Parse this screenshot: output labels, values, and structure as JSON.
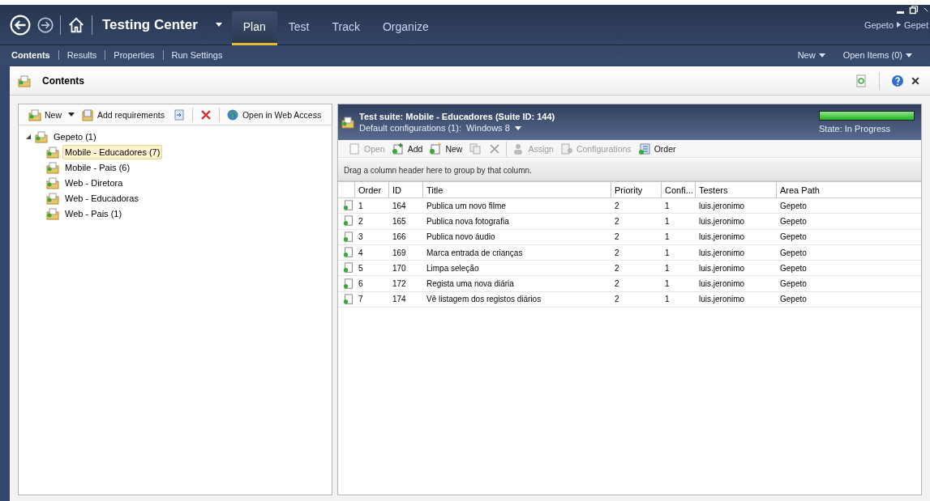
{
  "app_title": "Testing Center",
  "tabs": [
    {
      "label": "Plan",
      "selected": true
    },
    {
      "label": "Test",
      "selected": false
    },
    {
      "label": "Track",
      "selected": false
    },
    {
      "label": "Organize",
      "selected": false
    }
  ],
  "breadcrumb": [
    "Gepeto",
    "Gepet"
  ],
  "subtabs": [
    {
      "label": "Contents",
      "selected": true
    },
    {
      "label": "Results",
      "selected": false
    },
    {
      "label": "Properties",
      "selected": false
    },
    {
      "label": "Run Settings",
      "selected": false
    }
  ],
  "right_menus": [
    "New",
    "Open Items (0)"
  ],
  "panel_title": "Contents",
  "left_toolbar": [
    {
      "kind": "new",
      "label": "New"
    },
    {
      "kind": "requirements",
      "label": "Add requirements"
    },
    {
      "kind": "suite"
    },
    {
      "kind": "delete"
    },
    {
      "kind": "web",
      "label": "Open in Web Access"
    }
  ],
  "tree": {
    "label": "Gepeto (1)",
    "expanded": true,
    "selected": false,
    "children": [
      {
        "label": "Mobile - Educadores (7)",
        "selected": true
      },
      {
        "label": "Mobile - Pais (6)",
        "selected": false
      },
      {
        "label": "Web - Diretora",
        "selected": false
      },
      {
        "label": "Web - Educadoras",
        "selected": false
      },
      {
        "label": "Web - Pais (1)",
        "selected": false
      }
    ]
  },
  "suite": {
    "title": "Test suite:  Mobile - Educadores (Suite ID: 144)",
    "config_label": "Default configurations (1):",
    "config_value": "Windows 8",
    "progress": {
      "level": 1
    },
    "state": "State: In Progress"
  },
  "grid_toolbar": [
    {
      "kind": "open",
      "label": "Open",
      "disabled": true
    },
    {
      "kind": "add",
      "label": "Add",
      "disabled": false
    },
    {
      "kind": "new",
      "label": "New",
      "disabled": false
    },
    {
      "kind": "copy",
      "disabled": true
    },
    {
      "kind": "remove",
      "disabled": true
    },
    {
      "kind": "assign",
      "label": "Assign",
      "disabled": true
    },
    {
      "kind": "configurations",
      "label": "Configurations",
      "disabled": true
    },
    {
      "kind": "order",
      "label": "Order",
      "disabled": false
    }
  ],
  "group_hint": "Drag a column header here to group by that column.",
  "columns": [
    "Order",
    "ID",
    "Title",
    "Priority",
    "Confi...",
    "Testers",
    "Area Path"
  ],
  "rows": [
    [
      "1",
      "164",
      "Publica um novo filme",
      "2",
      "1",
      "luis.jeronimo",
      "Gepeto"
    ],
    [
      "2",
      "165",
      "Publica nova fotografia",
      "2",
      "1",
      "luis.jeronimo",
      "Gepeto"
    ],
    [
      "3",
      "166",
      "Publica novo áudio",
      "2",
      "1",
      "luis.jeronimo",
      "Gepeto"
    ],
    [
      "4",
      "169",
      "Marca entrada de crianças",
      "2",
      "1",
      "luis.jeronimo",
      "Gepeto"
    ],
    [
      "5",
      "170",
      "Limpa seleção",
      "2",
      "1",
      "luis.jeronimo",
      "Gepeto"
    ],
    [
      "6",
      "172",
      "Regista uma nova diária",
      "2",
      "1",
      "luis.jeronimo",
      "Gepeto"
    ],
    [
      "7",
      "174",
      "Vê listagem dos registos diários",
      "2",
      "1",
      "luis.jeronimo",
      "Gepeto"
    ]
  ]
}
